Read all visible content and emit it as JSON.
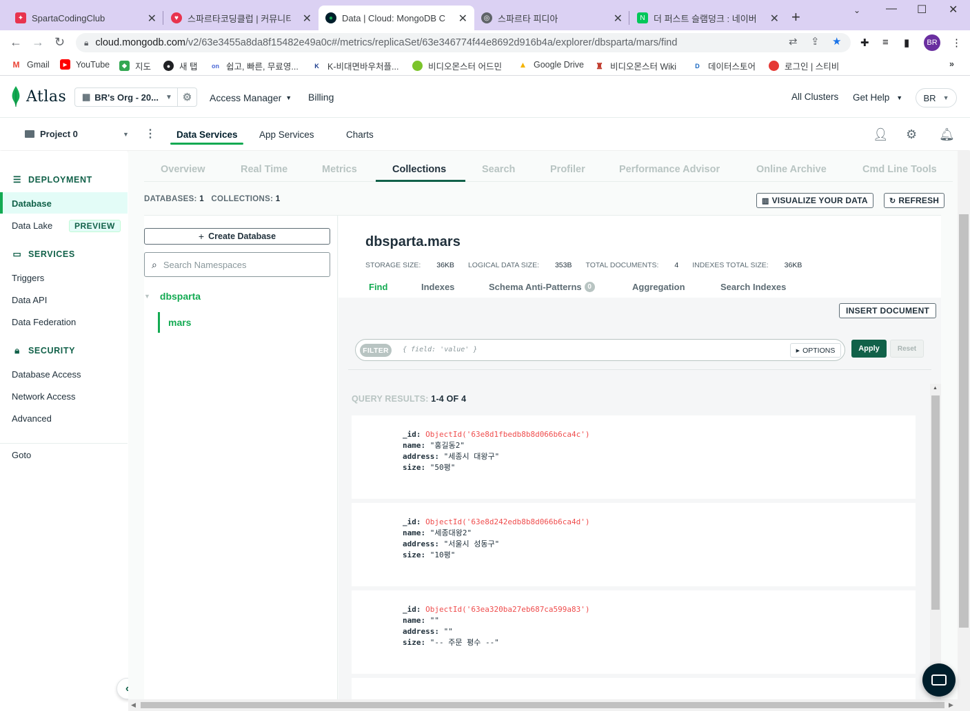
{
  "browser": {
    "tabs": [
      {
        "label": "SpartaCodingClub",
        "icon_color": "#e8344e",
        "active": false
      },
      {
        "label": "스파르타코딩클럽 | 커뮤니티",
        "icon_color": "#e8344e",
        "active": false
      },
      {
        "label": "Data | Cloud: MongoDB Cloud",
        "icon_color": "#001e2b",
        "active": true
      },
      {
        "label": "스파르타 피디아",
        "icon_color": "#5f6368",
        "active": false
      },
      {
        "label": "더 퍼스트 슬램덩크 : 네이버",
        "icon_color": "#03c75a",
        "active": false
      }
    ],
    "url_host": "cloud.mongodb.com",
    "url_path": "/v2/63e3455a8da8f15482e49a0c#/metrics/replicaSet/63e346774f44e8692d916b4a/explorer/dbsparta/mars/find",
    "profile": "BR",
    "bookmarks": [
      {
        "label": "Gmail",
        "icon": "M",
        "color": "#ea4335"
      },
      {
        "label": "YouTube",
        "icon": "▶",
        "color": "#ff0000"
      },
      {
        "label": "지도",
        "icon": "◆",
        "color": "#34a853"
      },
      {
        "label": "새 탭",
        "icon": "●",
        "color": "#202124"
      },
      {
        "label": "쉽고, 빠른, 무료영...",
        "icon": "on",
        "color": "#4a67d6"
      },
      {
        "label": "K-비대면바우처플...",
        "icon": "K",
        "color": "#1a3b8c"
      },
      {
        "label": "비디오몬스터 어드민",
        "icon": "●",
        "color": "#7bc42b"
      },
      {
        "label": "Google Drive",
        "icon": "▲",
        "color": "#f4b400"
      },
      {
        "label": "비디오몬스터 Wiki",
        "icon": "♜",
        "color": "#c0392b"
      },
      {
        "label": "데이터스토어",
        "icon": "D",
        "color": "#1565c0"
      },
      {
        "label": "로그인 | 스티비",
        "icon": "●",
        "color": "#e53935"
      }
    ]
  },
  "atlas": {
    "brand": "Atlas",
    "org": "BR's Org - 20...",
    "topnav": {
      "access_manager": "Access Manager",
      "billing": "Billing",
      "all_clusters": "All Clusters",
      "get_help": "Get Help",
      "user": "BR"
    },
    "project": "Project 0",
    "project_tabs": {
      "data_services": "Data Services",
      "app_services": "App Services",
      "charts": "Charts"
    }
  },
  "sidebar": {
    "deployment": "DEPLOYMENT",
    "database": "Database",
    "data_lake": "Data Lake",
    "preview": "PREVIEW",
    "services": "SERVICES",
    "triggers": "Triggers",
    "data_api": "Data API",
    "data_federation": "Data Federation",
    "security": "SECURITY",
    "database_access": "Database Access",
    "network_access": "Network Access",
    "advanced": "Advanced",
    "goto": "Goto"
  },
  "cluster_tabs": {
    "overview": "Overview",
    "real_time": "Real Time",
    "metrics": "Metrics",
    "collections": "Collections",
    "search": "Search",
    "profiler": "Profiler",
    "performance_advisor": "Performance Advisor",
    "online_archive": "Online Archive",
    "cmd_line_tools": "Cmd Line Tools"
  },
  "counts": {
    "databases_label": "DATABASES:",
    "databases": "1",
    "collections_label": "COLLECTIONS:",
    "collections": "1"
  },
  "actions": {
    "visualize": "VISUALIZE YOUR DATA",
    "refresh": "REFRESH"
  },
  "namespaces": {
    "create_database": "Create Database",
    "search_placeholder": "Search Namespaces",
    "database": "dbsparta",
    "collection": "mars"
  },
  "collection": {
    "title": "dbsparta.mars",
    "stats": [
      {
        "label": "STORAGE SIZE:",
        "value": "36KB"
      },
      {
        "label": "LOGICAL DATA SIZE:",
        "value": "353B"
      },
      {
        "label": "TOTAL DOCUMENTS:",
        "value": "4"
      },
      {
        "label": "INDEXES TOTAL SIZE:",
        "value": "36KB"
      }
    ],
    "subtabs": {
      "find": "Find",
      "indexes": "Indexes",
      "schema": "Schema Anti-Patterns",
      "schema_count": "0",
      "aggregation": "Aggregation",
      "search_indexes": "Search Indexes"
    },
    "insert_document": "INSERT DOCUMENT",
    "filter": {
      "label": "FILTER",
      "placeholder": "{ field: 'value' }",
      "options": "OPTIONS",
      "apply": "Apply",
      "reset": "Reset"
    },
    "query_results_label": "QUERY RESULTS:",
    "query_results_count": "1-4 OF 4",
    "documents": [
      {
        "id": "ObjectId('63e8d1fbedb8b8d066b6ca4c')",
        "name": "\"홍길동2\"",
        "address": "\"세종시 대왕구\"",
        "size": "\"50평\""
      },
      {
        "id": "ObjectId('63e8d242edb8b8d066b6ca4d')",
        "name": "\"세종대왕2\"",
        "address": "\"서울시 성동구\"",
        "size": "\"10평\""
      },
      {
        "id": "ObjectId('63ea320ba27eb687ca599a83')",
        "name": "\"\"",
        "address": "\"\"",
        "size": "\"-- 주문 평수 --\""
      }
    ],
    "field_labels": {
      "id": "_id:",
      "name": "name:",
      "address": "address:",
      "size": "size:"
    }
  }
}
